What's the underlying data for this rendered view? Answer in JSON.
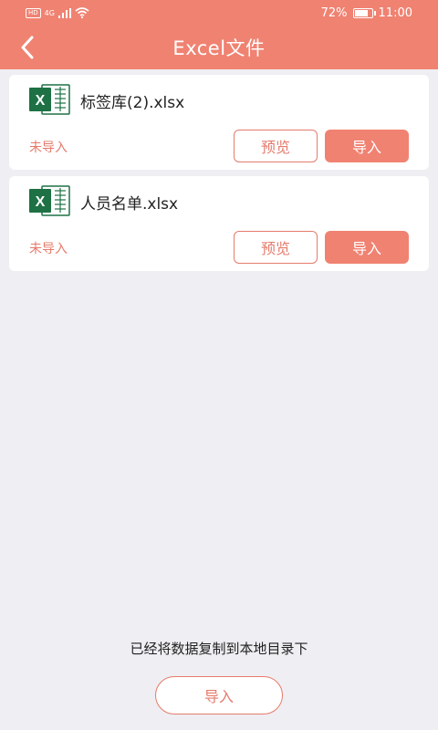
{
  "status_bar": {
    "hd": "HD",
    "network": "4G",
    "battery_pct": "72%",
    "time": "11:00"
  },
  "header": {
    "back_icon": "chevron-left-icon",
    "title": "Excel文件"
  },
  "files": [
    {
      "name": "标签库(2).xlsx",
      "status": "未导入",
      "preview_label": "预览",
      "import_label": "导入"
    },
    {
      "name": "人员名单.xlsx",
      "status": "未导入",
      "preview_label": "预览",
      "import_label": "导入"
    }
  ],
  "footer": {
    "toast": "已经将数据复制到本地目录下",
    "import_label": "导入"
  },
  "colors": {
    "accent": "#f08272",
    "accent_text": "#e57b6c",
    "background": "#efeef2",
    "excel_green": "#1e7145"
  }
}
